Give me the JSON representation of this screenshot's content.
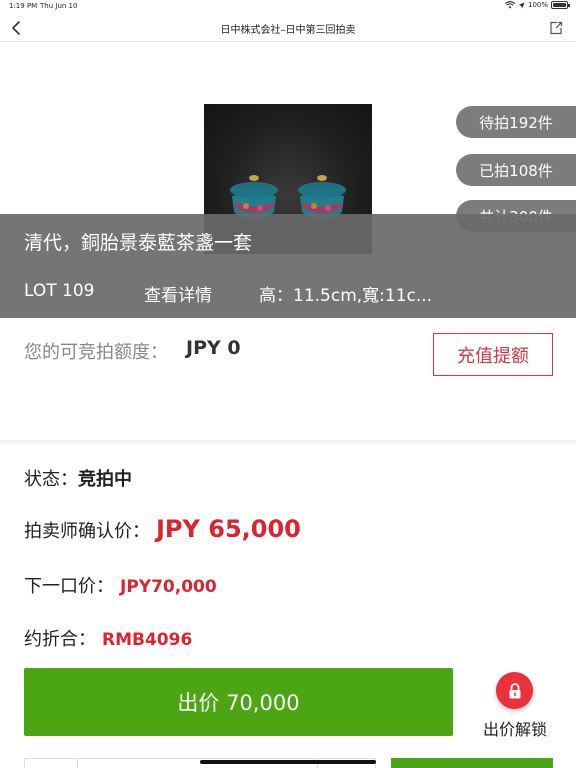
{
  "status_bar": {
    "time": "1:19 PM",
    "date": "Thu Jun 10",
    "battery": "100%"
  },
  "nav": {
    "title": "日中株式会社–日中第三回拍卖",
    "back_icon": "chevron-left-icon",
    "share_icon": "share-icon"
  },
  "hero": {
    "pills": [
      {
        "label": "待拍192件"
      },
      {
        "label": "已拍108件"
      },
      {
        "label": "共计300件"
      }
    ],
    "lot_title": "清代，銅胎景泰藍茶盞一套",
    "lot_no": "LOT 109",
    "detail_link": "查看详情",
    "dimensions": "高：11.5cm,寬:11c..."
  },
  "credit": {
    "label": "您的可竞拍额度：",
    "value": "JPY 0",
    "recharge_button": "充值提额"
  },
  "auction": {
    "status_label": "状态：",
    "status_value": "竞拍中",
    "confirm_label": "拍卖师确认价：",
    "confirm_value": "JPY 65,000",
    "next_label": "下一口价：",
    "next_value": "JPY70,000",
    "approx_label": "约折合：",
    "approx_value": "RMB4096"
  },
  "actions": {
    "bid_button": "出价 70,000",
    "unlock_label": "出价解锁",
    "unlock_icon": "lock-icon"
  },
  "colors": {
    "accent_red": "#d9252f",
    "bid_green": "#4ca513",
    "pill_gray": "#7c7c7c"
  }
}
